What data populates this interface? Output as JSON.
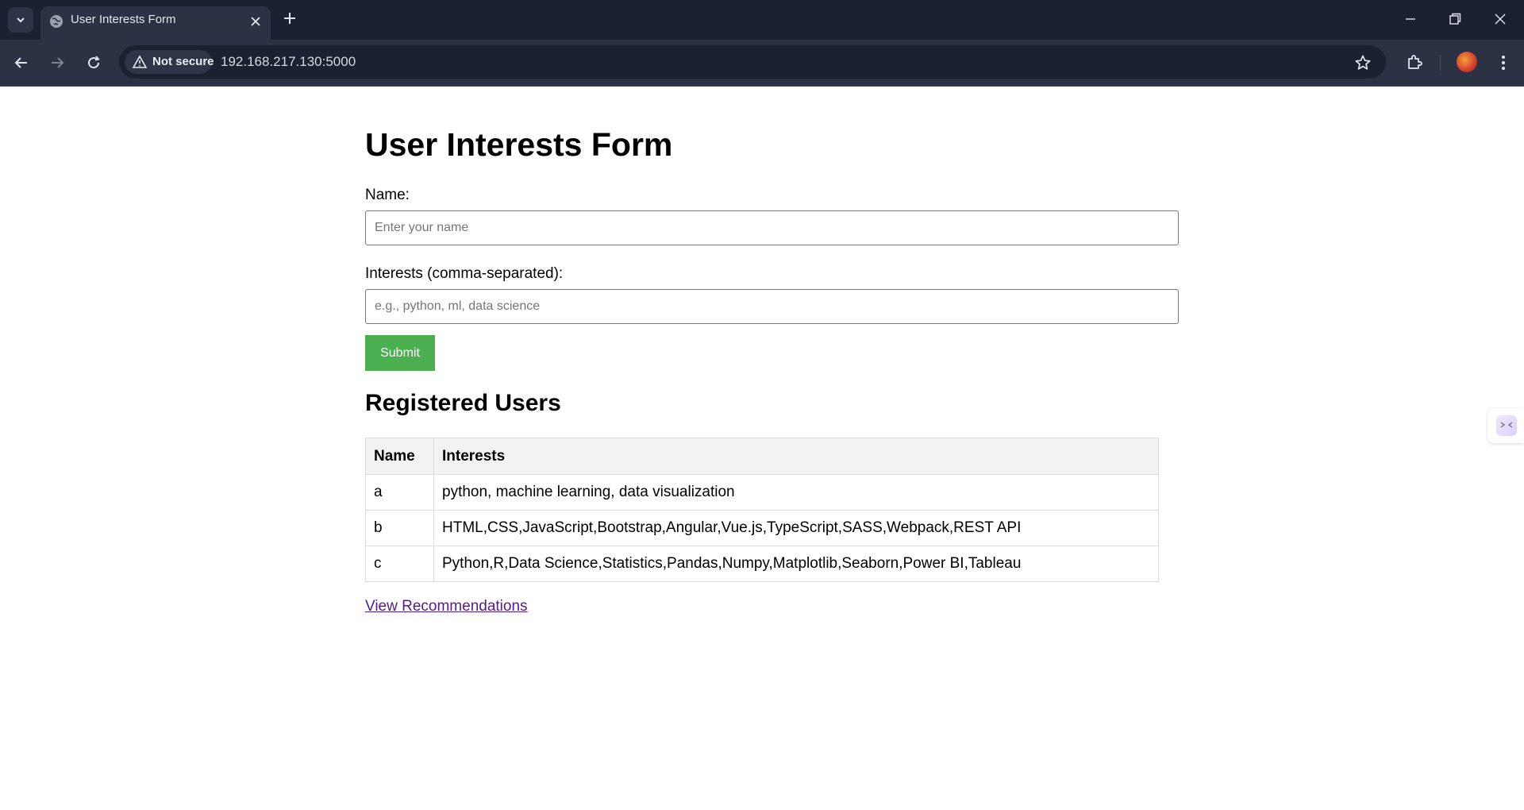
{
  "browser": {
    "tab_title": "User Interests Form",
    "security_label": "Not secure",
    "url": "192.168.217.130:5000",
    "icons": {
      "tab_list": "chevron-down-icon",
      "favicon": "globe-icon",
      "tab_close": "close-icon",
      "new_tab": "plus-icon",
      "back": "back-arrow-icon",
      "forward": "forward-arrow-icon",
      "reload": "reload-icon",
      "warning": "warning-icon",
      "bookmark": "star-icon",
      "extensions": "puzzle-icon",
      "profile": "avatar",
      "menu": "kebab-menu-icon",
      "minimize": "minimize-icon",
      "restore": "restore-icon",
      "close_window": "close-icon"
    }
  },
  "form": {
    "title": "User Interests Form",
    "name_label": "Name:",
    "name_placeholder": "Enter your name",
    "name_value": "",
    "interests_label": "Interests (comma-separated):",
    "interests_placeholder": "e.g., python, ml, data science",
    "interests_value": "",
    "submit_label": "Submit",
    "submit_color": "#4caf50"
  },
  "users": {
    "heading": "Registered Users",
    "columns": [
      "Name",
      "Interests"
    ],
    "rows": [
      {
        "name": "a",
        "interests": "python, machine learning, data visualization"
      },
      {
        "name": "b",
        "interests": "HTML,CSS,JavaScript,Bootstrap,Angular,Vue.js,TypeScript,SASS,Webpack,REST API"
      },
      {
        "name": "c",
        "interests": "Python,R,Data Science,Statistics,Pandas,Numpy,Matplotlib,Seaborn,Power BI,Tableau"
      }
    ]
  },
  "link": {
    "label": "View Recommendations",
    "color": "#551a8b"
  }
}
